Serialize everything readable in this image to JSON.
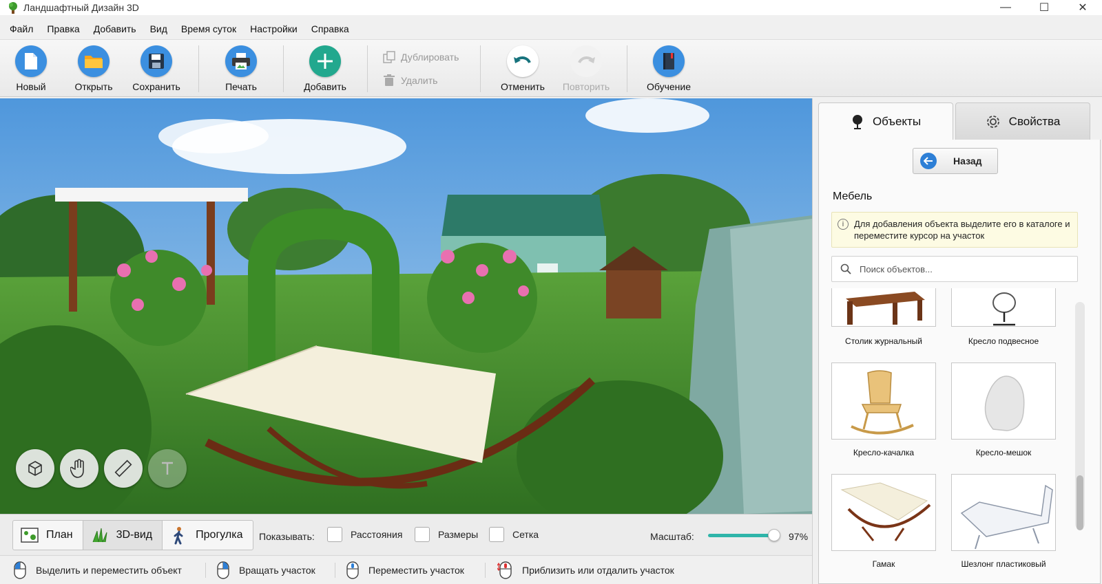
{
  "window": {
    "title": "Ландшафтный Дизайн 3D",
    "minimize": "—",
    "maximize": "☐",
    "close": "✕"
  },
  "menu": [
    "Файл",
    "Правка",
    "Добавить",
    "Вид",
    "Время суток",
    "Настройки",
    "Справка"
  ],
  "toolbar": {
    "new": "Новый",
    "open": "Открыть",
    "save": "Сохранить",
    "print": "Печать",
    "add": "Добавить",
    "duplicate": "Дублировать",
    "delete": "Удалить",
    "undo": "Отменить",
    "redo": "Повторить",
    "tutorial": "Обучение"
  },
  "viewbar": {
    "tabs": [
      "План",
      "3D-вид",
      "Прогулка"
    ],
    "active_tab": "3D-вид",
    "show_label": "Показывать:",
    "checkboxes": [
      "Расстояния",
      "Размеры",
      "Сетка"
    ],
    "zoom_label": "Масштаб:",
    "zoom_value": "97%",
    "zoom_fraction": 0.97
  },
  "statusbar": {
    "hints": [
      "Выделить и переместить объект",
      "Вращать участок",
      "Переместить участок",
      "Приблизить или отдалить участок"
    ]
  },
  "panel": {
    "tab_objects": "Объекты",
    "tab_properties": "Свойства",
    "back": "Назад",
    "category": "Мебель",
    "info": "Для добавления объекта выделите его в каталоге и переместите курсор на участок",
    "search_placeholder": "Поиск объектов...",
    "items": [
      "Столик журнальный",
      "Кресло подвесное",
      "Кресло-качалка",
      "Кресло-мешок",
      "Гамак",
      "Шезлонг пластиковый"
    ]
  },
  "colors": {
    "accent": "#2fb5a9",
    "blue": "#2d7fd6",
    "grass": "#3f8a2a",
    "sky": "#6aa6de"
  }
}
